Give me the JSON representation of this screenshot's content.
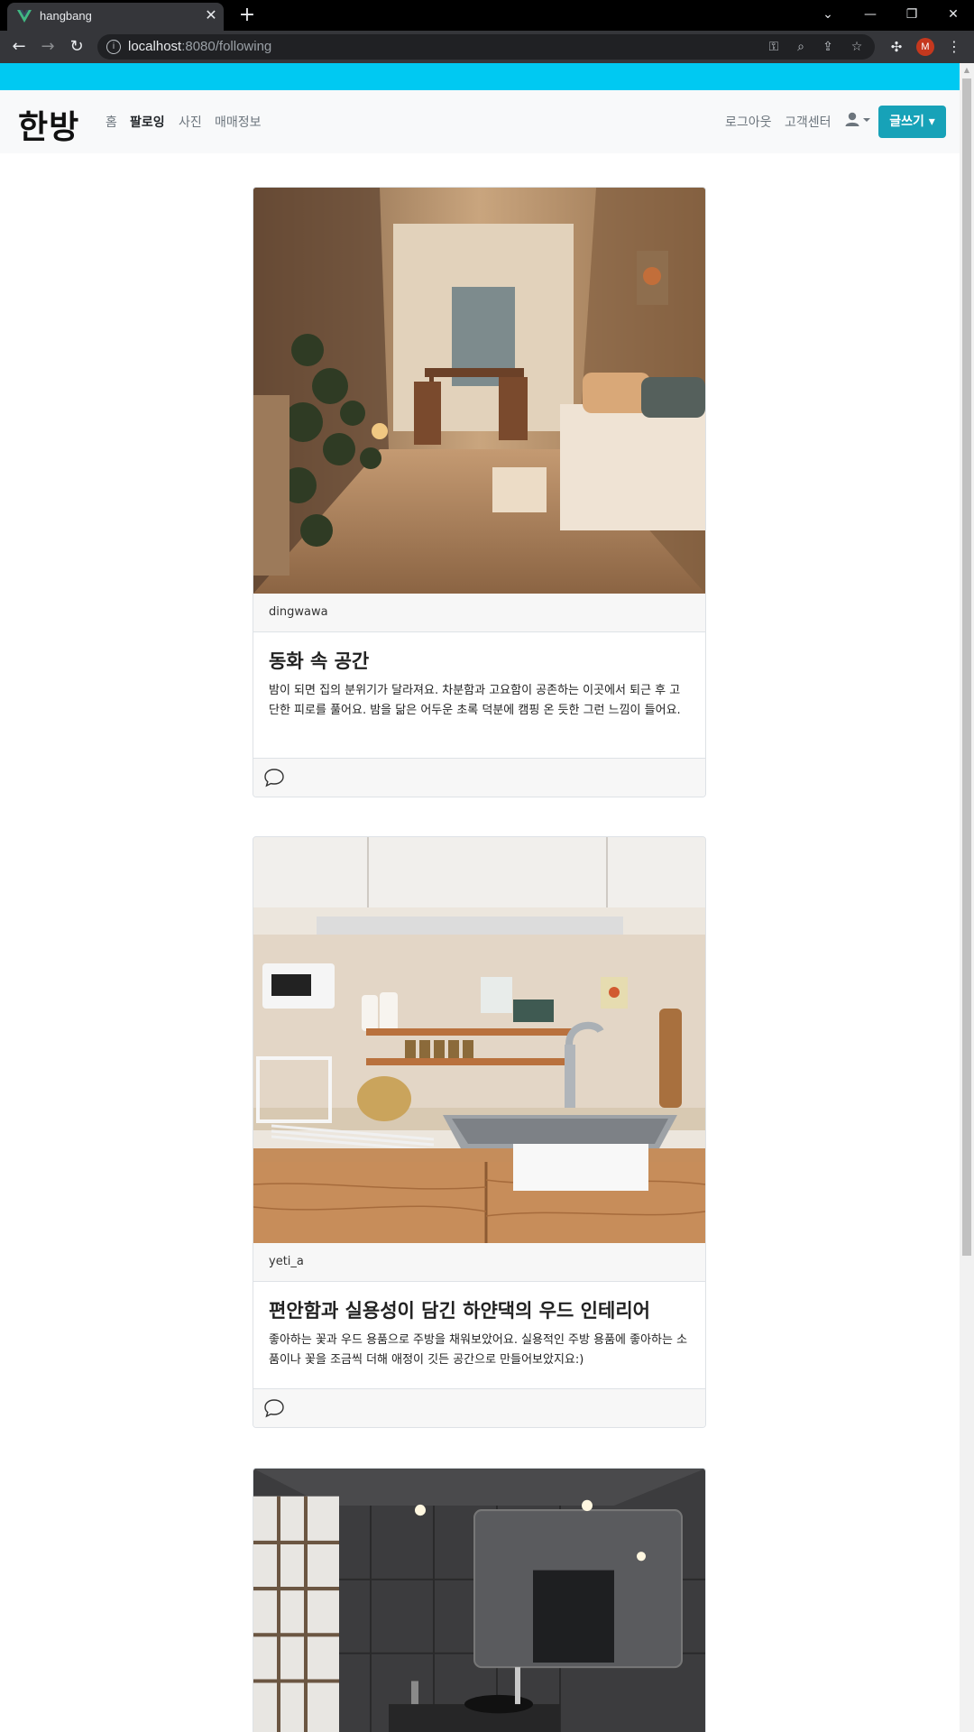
{
  "browser": {
    "tab_title": "hangbang",
    "url_host": "localhost",
    "url_rest": ":8080/following",
    "profile_initial": "M"
  },
  "navbar": {
    "brand": "한방",
    "links": [
      "홈",
      "팔로잉",
      "사진",
      "매매정보"
    ],
    "active_link": "팔로잉",
    "right_links": [
      "로그아웃",
      "고객센터"
    ],
    "write_button": "글쓰기"
  },
  "posts": [
    {
      "author": "dingwawa",
      "title": "동화 속 공간",
      "text": "밤이 되면 집의 분위기가 달라져요. 차분함과 고요함이 공존하는 이곳에서 퇴근 후 고단한 피로를 풀어요. 밤을 닮은 어두운 초록 덕분에 캠핑 온 듯한 그런 느낌이 들어요."
    },
    {
      "author": "yeti_a",
      "title": "편안함과 실용성이 담긴 하얀댁의 우드 인테리어",
      "text": "좋아하는 꽃과 우드 용품으로 주방을 채워보았어요. 실용적인 주방 용품에 좋아하는 소품이나 꽃을 조금씩 더해 애정이 깃든 공간으로 만들어보았지요:)"
    },
    {
      "author": "",
      "title": "",
      "text": ""
    }
  ],
  "colors": {
    "accent_bar": "#00c9f2",
    "write_button": "#17a2b8"
  }
}
